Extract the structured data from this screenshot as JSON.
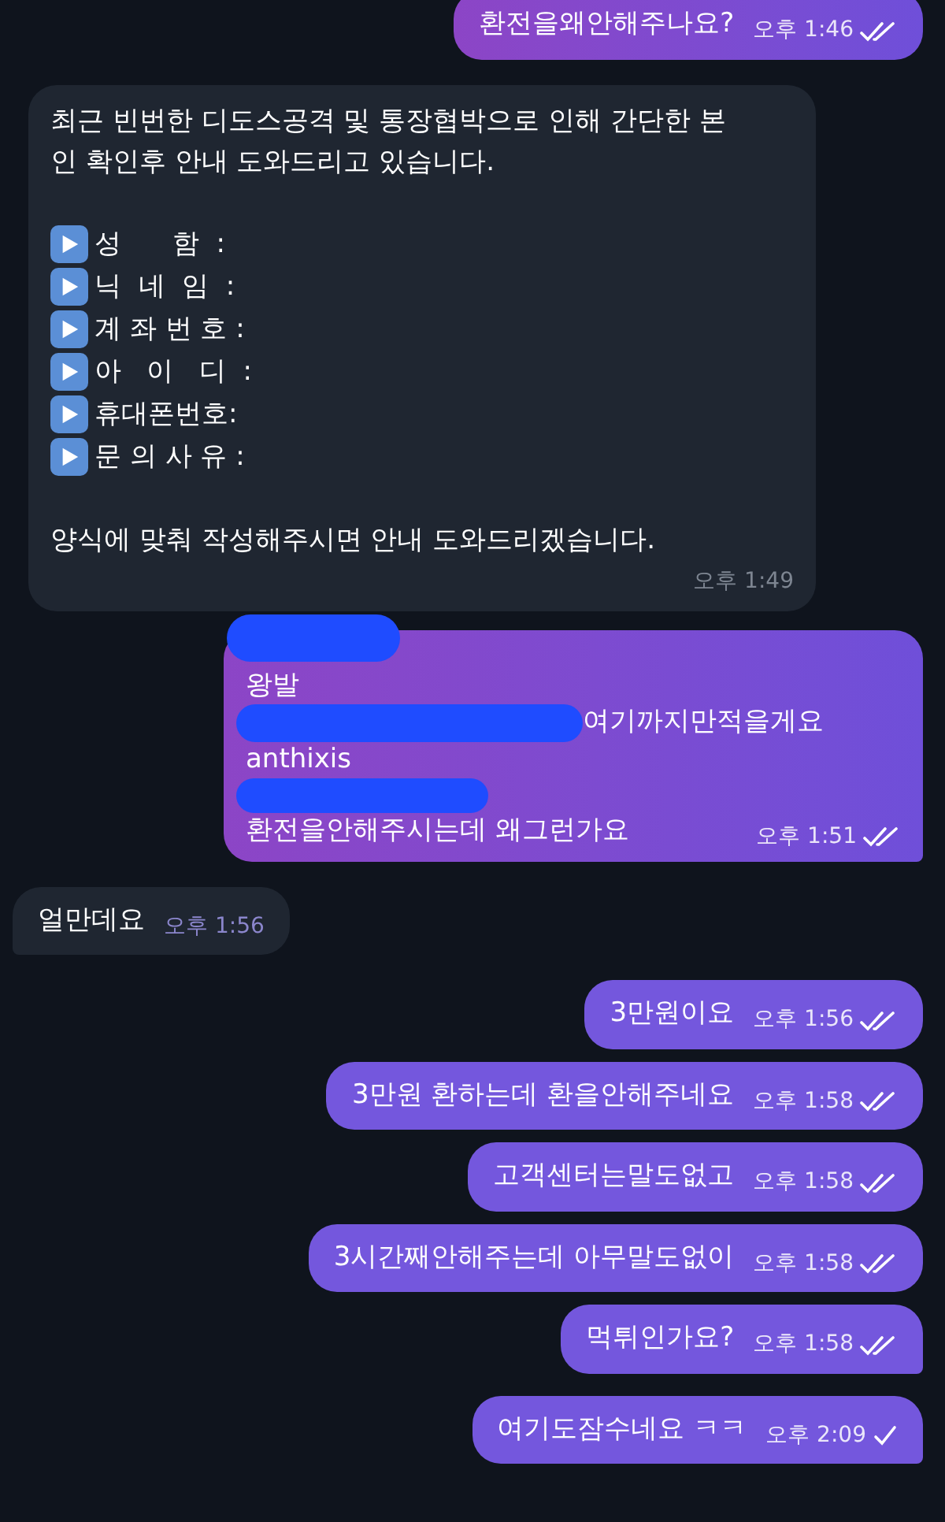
{
  "messages": [
    {
      "kind": "text",
      "outgoing": true,
      "text": "환전을왜안해주나요?",
      "time": "오후 1:46",
      "read": true,
      "tail": false
    },
    {
      "kind": "form",
      "outgoing": false,
      "intro": "최근 빈번한 디도스공격 및 통장협박으로 인해 간단한 본인 확인후 안내 도와드리고 있습니다.",
      "fields": [
        "성      함  :",
        "닉  네  임  :",
        "계 좌 번 호 :",
        "아   이   디  :",
        "휴대폰번호:",
        "문 의 사 유 :"
      ],
      "outro": "양식에 맞춰 작성해주시면 안내 도와드리겠습니다.",
      "time": "오후 1:49",
      "tail": false
    },
    {
      "kind": "lines",
      "outgoing": true,
      "lines": [
        {
          "kind": "scribble"
        },
        {
          "kind": "text",
          "text": "왕발"
        },
        {
          "kind": "text",
          "text": "여기까지만적을게요",
          "scribble_before": true
        },
        {
          "kind": "text",
          "text": "anthixis"
        },
        {
          "kind": "scribble"
        },
        {
          "kind": "text",
          "text": "환전을안해주시는데 왜그런가요"
        }
      ],
      "time": "오후 1:51",
      "read": true,
      "tail": true
    },
    {
      "kind": "text",
      "outgoing": false,
      "text": "얼만데요",
      "time": "오후 1:56",
      "tail": true
    },
    {
      "kind": "text",
      "outgoing": true,
      "text": "3만원이요",
      "time": "오후 1:56",
      "read": true,
      "tail": false
    },
    {
      "kind": "text",
      "outgoing": true,
      "text": "3만원 환하는데 환을안해주네요",
      "time": "오후 1:58",
      "read": true,
      "tail": false
    },
    {
      "kind": "text",
      "outgoing": true,
      "text": "고객센터는말도없고",
      "time": "오후 1:58",
      "read": true,
      "tail": false
    },
    {
      "kind": "text",
      "outgoing": true,
      "text": "3시간째안해주는데 아무말도없이",
      "time": "오후 1:58",
      "read": true,
      "tail": false
    },
    {
      "kind": "text",
      "outgoing": true,
      "text": "먹튀인가요?",
      "time": "오후 1:58",
      "read": true,
      "tail": true
    },
    {
      "kind": "text",
      "outgoing": true,
      "text": "여기도잠수네요 ㅋㅋ",
      "time": "오후 2:09",
      "read": false,
      "tail": true
    }
  ]
}
